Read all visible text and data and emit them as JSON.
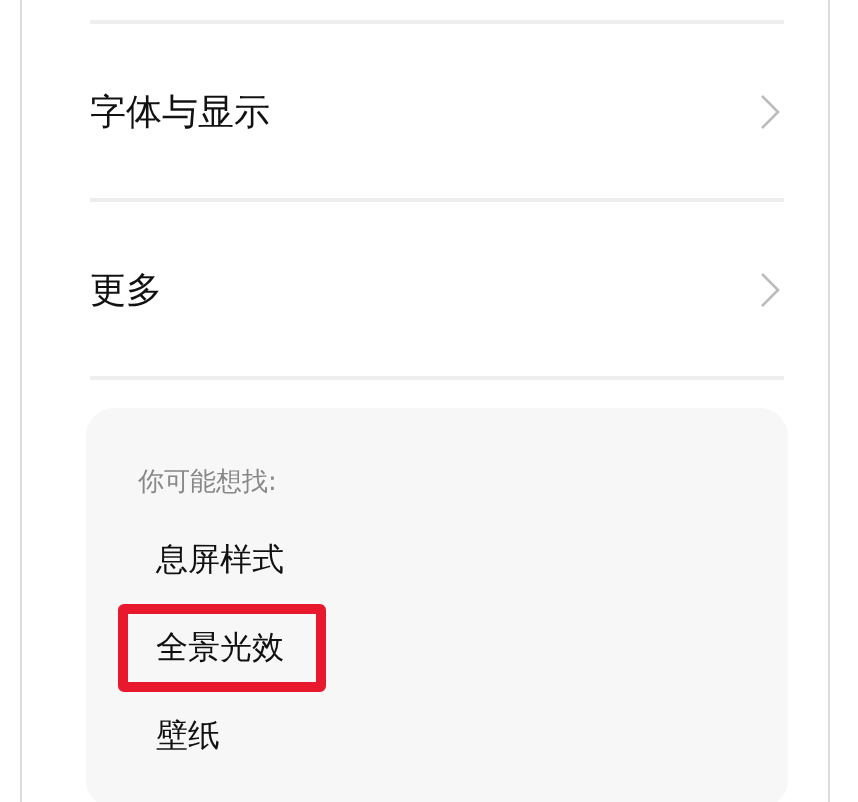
{
  "settings_rows": [
    {
      "label": "字体与显示"
    },
    {
      "label": "更多"
    }
  ],
  "suggestions": {
    "heading": "你可能想找:",
    "items": [
      {
        "label": "息屏样式",
        "highlighted": false
      },
      {
        "label": "全景光效",
        "highlighted": true
      },
      {
        "label": "壁纸",
        "highlighted": false
      }
    ]
  }
}
